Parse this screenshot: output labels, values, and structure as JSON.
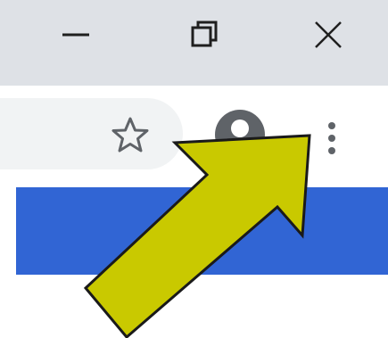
{
  "window_controls": {
    "minimize_icon": "minimize-icon",
    "restore_icon": "restore-icon",
    "close_icon": "close-icon"
  },
  "toolbar": {
    "bookmark_icon": "star-icon",
    "profile_icon": "profile-icon",
    "menu_icon": "more-vert-icon"
  },
  "colors": {
    "titlebar": "#dee1e6",
    "omnibox": "#f1f3f4",
    "content_band": "#3165d4",
    "arrow_fill": "#c9c900",
    "arrow_stroke": "#1a1a1a"
  }
}
